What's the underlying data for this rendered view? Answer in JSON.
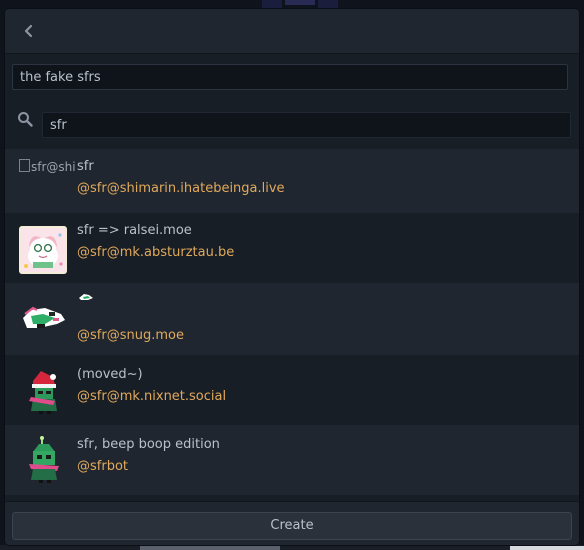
{
  "window": {
    "back_icon": "chevron-left-icon"
  },
  "list_name": {
    "value": "the fake sfrs"
  },
  "search": {
    "icon": "search-icon",
    "value": "sfr"
  },
  "results": [
    {
      "name": "sfr",
      "handle": "@sfr@shimarin.ihatebeinga.live",
      "avatar_alt": "sfr@shi",
      "avatar": "broken-image"
    },
    {
      "name": "sfr => ralsei.moe",
      "handle": "@sfr@mk.absturztau.be",
      "avatar": "ralsei-art-avatar"
    },
    {
      "name": "",
      "handle": "@sfr@snug.moe",
      "avatar": "ralsei-lying-avatar"
    },
    {
      "name": "(moved~)",
      "handle": "@sfr@mk.nixnet.social",
      "avatar": "ralsei-santa-hat-avatar"
    },
    {
      "name": "sfr, beep boop edition",
      "handle": "@sfrbot",
      "avatar": "ralsei-bot-avatar"
    }
  ],
  "footer": {
    "create_label": "Create"
  },
  "colors": {
    "accent_handle": "#e1a95b",
    "panel": "#181e26",
    "panel_alt": "#1f2630",
    "text": "#b9c1ca"
  }
}
